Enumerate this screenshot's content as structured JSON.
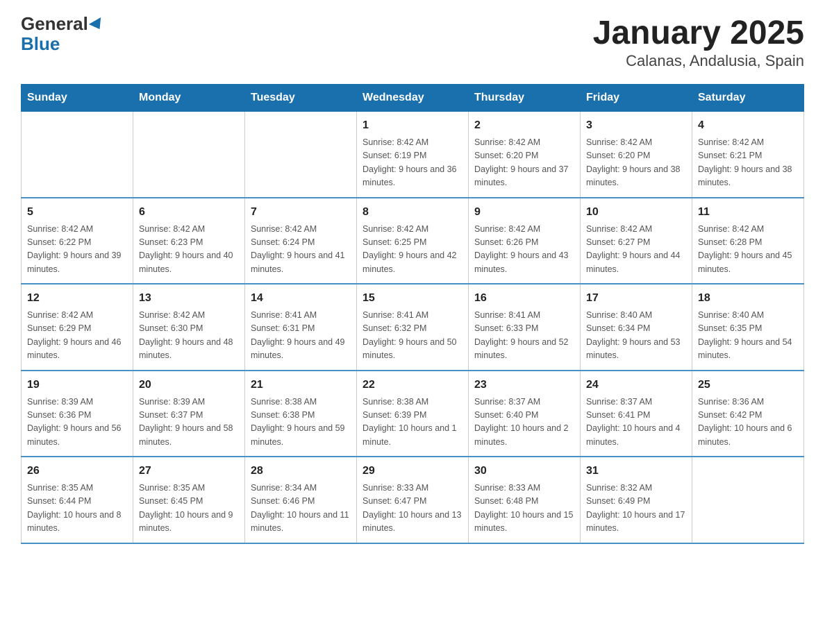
{
  "header": {
    "logo_line1": "General",
    "logo_line2": "Blue",
    "title": "January 2025",
    "subtitle": "Calanas, Andalusia, Spain"
  },
  "days_of_week": [
    "Sunday",
    "Monday",
    "Tuesday",
    "Wednesday",
    "Thursday",
    "Friday",
    "Saturday"
  ],
  "weeks": [
    [
      {
        "num": "",
        "info": ""
      },
      {
        "num": "",
        "info": ""
      },
      {
        "num": "",
        "info": ""
      },
      {
        "num": "1",
        "info": "Sunrise: 8:42 AM\nSunset: 6:19 PM\nDaylight: 9 hours and 36 minutes."
      },
      {
        "num": "2",
        "info": "Sunrise: 8:42 AM\nSunset: 6:20 PM\nDaylight: 9 hours and 37 minutes."
      },
      {
        "num": "3",
        "info": "Sunrise: 8:42 AM\nSunset: 6:20 PM\nDaylight: 9 hours and 38 minutes."
      },
      {
        "num": "4",
        "info": "Sunrise: 8:42 AM\nSunset: 6:21 PM\nDaylight: 9 hours and 38 minutes."
      }
    ],
    [
      {
        "num": "5",
        "info": "Sunrise: 8:42 AM\nSunset: 6:22 PM\nDaylight: 9 hours and 39 minutes."
      },
      {
        "num": "6",
        "info": "Sunrise: 8:42 AM\nSunset: 6:23 PM\nDaylight: 9 hours and 40 minutes."
      },
      {
        "num": "7",
        "info": "Sunrise: 8:42 AM\nSunset: 6:24 PM\nDaylight: 9 hours and 41 minutes."
      },
      {
        "num": "8",
        "info": "Sunrise: 8:42 AM\nSunset: 6:25 PM\nDaylight: 9 hours and 42 minutes."
      },
      {
        "num": "9",
        "info": "Sunrise: 8:42 AM\nSunset: 6:26 PM\nDaylight: 9 hours and 43 minutes."
      },
      {
        "num": "10",
        "info": "Sunrise: 8:42 AM\nSunset: 6:27 PM\nDaylight: 9 hours and 44 minutes."
      },
      {
        "num": "11",
        "info": "Sunrise: 8:42 AM\nSunset: 6:28 PM\nDaylight: 9 hours and 45 minutes."
      }
    ],
    [
      {
        "num": "12",
        "info": "Sunrise: 8:42 AM\nSunset: 6:29 PM\nDaylight: 9 hours and 46 minutes."
      },
      {
        "num": "13",
        "info": "Sunrise: 8:42 AM\nSunset: 6:30 PM\nDaylight: 9 hours and 48 minutes."
      },
      {
        "num": "14",
        "info": "Sunrise: 8:41 AM\nSunset: 6:31 PM\nDaylight: 9 hours and 49 minutes."
      },
      {
        "num": "15",
        "info": "Sunrise: 8:41 AM\nSunset: 6:32 PM\nDaylight: 9 hours and 50 minutes."
      },
      {
        "num": "16",
        "info": "Sunrise: 8:41 AM\nSunset: 6:33 PM\nDaylight: 9 hours and 52 minutes."
      },
      {
        "num": "17",
        "info": "Sunrise: 8:40 AM\nSunset: 6:34 PM\nDaylight: 9 hours and 53 minutes."
      },
      {
        "num": "18",
        "info": "Sunrise: 8:40 AM\nSunset: 6:35 PM\nDaylight: 9 hours and 54 minutes."
      }
    ],
    [
      {
        "num": "19",
        "info": "Sunrise: 8:39 AM\nSunset: 6:36 PM\nDaylight: 9 hours and 56 minutes."
      },
      {
        "num": "20",
        "info": "Sunrise: 8:39 AM\nSunset: 6:37 PM\nDaylight: 9 hours and 58 minutes."
      },
      {
        "num": "21",
        "info": "Sunrise: 8:38 AM\nSunset: 6:38 PM\nDaylight: 9 hours and 59 minutes."
      },
      {
        "num": "22",
        "info": "Sunrise: 8:38 AM\nSunset: 6:39 PM\nDaylight: 10 hours and 1 minute."
      },
      {
        "num": "23",
        "info": "Sunrise: 8:37 AM\nSunset: 6:40 PM\nDaylight: 10 hours and 2 minutes."
      },
      {
        "num": "24",
        "info": "Sunrise: 8:37 AM\nSunset: 6:41 PM\nDaylight: 10 hours and 4 minutes."
      },
      {
        "num": "25",
        "info": "Sunrise: 8:36 AM\nSunset: 6:42 PM\nDaylight: 10 hours and 6 minutes."
      }
    ],
    [
      {
        "num": "26",
        "info": "Sunrise: 8:35 AM\nSunset: 6:44 PM\nDaylight: 10 hours and 8 minutes."
      },
      {
        "num": "27",
        "info": "Sunrise: 8:35 AM\nSunset: 6:45 PM\nDaylight: 10 hours and 9 minutes."
      },
      {
        "num": "28",
        "info": "Sunrise: 8:34 AM\nSunset: 6:46 PM\nDaylight: 10 hours and 11 minutes."
      },
      {
        "num": "29",
        "info": "Sunrise: 8:33 AM\nSunset: 6:47 PM\nDaylight: 10 hours and 13 minutes."
      },
      {
        "num": "30",
        "info": "Sunrise: 8:33 AM\nSunset: 6:48 PM\nDaylight: 10 hours and 15 minutes."
      },
      {
        "num": "31",
        "info": "Sunrise: 8:32 AM\nSunset: 6:49 PM\nDaylight: 10 hours and 17 minutes."
      },
      {
        "num": "",
        "info": ""
      }
    ]
  ]
}
